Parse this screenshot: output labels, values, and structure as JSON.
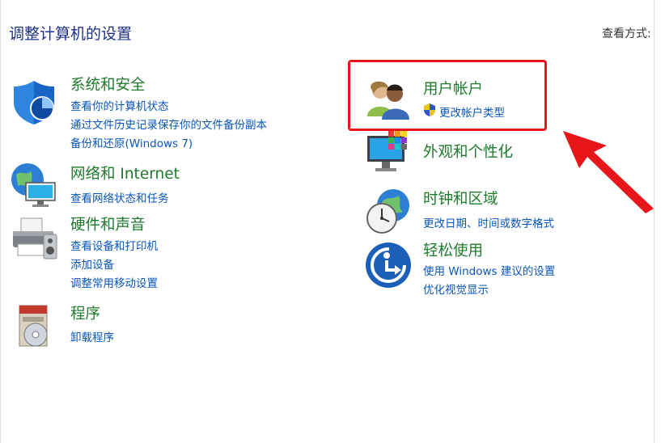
{
  "header": {
    "title": "调整计算机的设置",
    "view_by_label": "查看方式:"
  },
  "categories": {
    "system": {
      "title": "系统和安全",
      "icon": "shield-icon",
      "links": [
        "查看你的计算机状态",
        "通过文件历史记录保存你的文件备份副本",
        "备份和还原(Windows 7)"
      ]
    },
    "network": {
      "title": "网络和 Internet",
      "icon": "network-globe-icon",
      "links": [
        "查看网络状态和任务"
      ]
    },
    "hardware": {
      "title": "硬件和声音",
      "icon": "printer-icon",
      "links": [
        "查看设备和打印机",
        "添加设备",
        "调整常用移动设置"
      ]
    },
    "programs": {
      "title": "程序",
      "icon": "programs-disc-icon",
      "links": [
        "卸载程序"
      ]
    },
    "user_accounts": {
      "title": "用户帐户",
      "icon": "users-icon",
      "links": [
        "更改帐户类型"
      ]
    },
    "appearance": {
      "title": "外观和个性化",
      "icon": "monitor-palette-icon",
      "links": []
    },
    "clock": {
      "title": "时钟和区域",
      "icon": "clock-globe-icon",
      "links": [
        "更改日期、时间或数字格式"
      ]
    },
    "ease": {
      "title": "轻松使用",
      "icon": "ease-of-access-icon",
      "links": [
        "使用 Windows 建议的设置",
        "优化视觉显示"
      ]
    }
  },
  "colors": {
    "title_blue": "#1e3287",
    "category_green": "#1e7a2c",
    "link_blue": "#0a56b8",
    "annotation_red": "#e8161b"
  }
}
